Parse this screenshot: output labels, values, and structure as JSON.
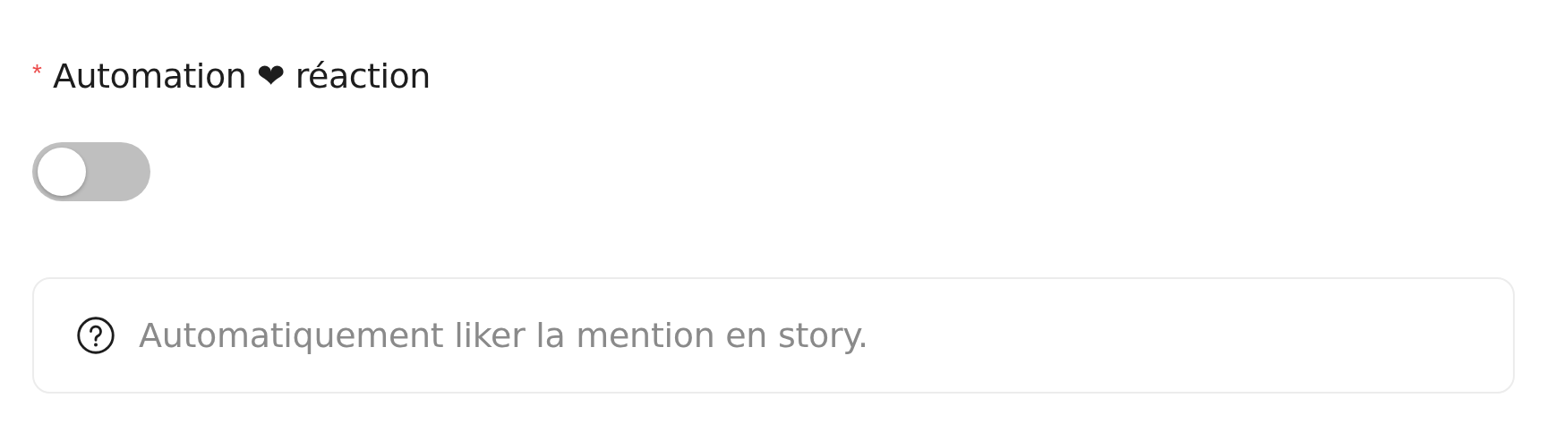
{
  "field": {
    "required_mark": "*",
    "label": "Automation ❤ réaction"
  },
  "toggle": {
    "on": false
  },
  "hint": {
    "text": "Automatiquement liker la mention en story."
  }
}
